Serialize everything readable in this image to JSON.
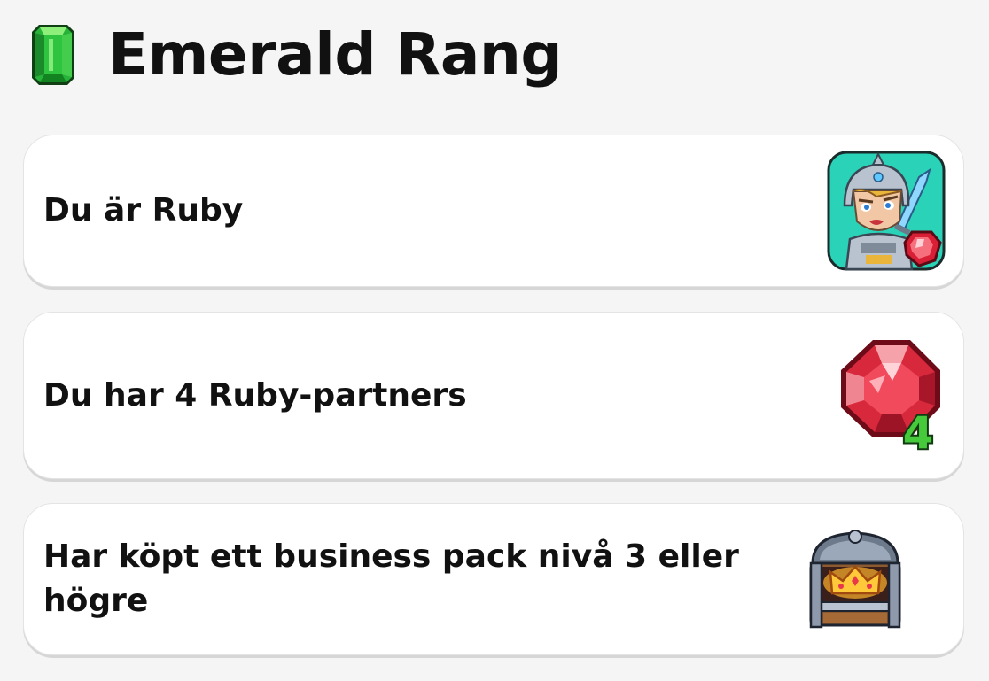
{
  "header": {
    "title": "Emerald Rang",
    "icon": "emerald-gem-icon",
    "accent_color": "#1fbf3a"
  },
  "requirements": [
    {
      "label": "Du är Ruby",
      "icon": "knight-avatar-with-ruby-icon"
    },
    {
      "label": "Du har 4 Ruby-partners",
      "icon": "ruby-gem-with-count-icon",
      "badge": "4"
    },
    {
      "label": "Har köpt ett business pack nivå 3 eller högre",
      "icon": "treasure-chest-crown-icon"
    }
  ],
  "colors": {
    "background": "#f5f5f5",
    "card": "#ffffff",
    "ruby": "#e8384a",
    "badge": "#46c93a"
  }
}
